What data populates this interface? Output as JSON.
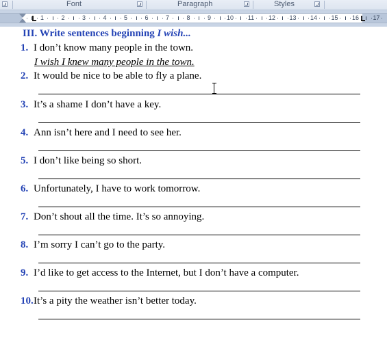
{
  "ribbon": {
    "groups": [
      {
        "label": "Font"
      },
      {
        "label": "Paragraph"
      },
      {
        "label": "Styles"
      }
    ]
  },
  "ruler": {
    "numbers": [
      "1",
      "2",
      "3",
      "4",
      "5",
      "6",
      "7",
      "8",
      "9",
      "10",
      "11",
      "12",
      "13",
      "14",
      "15",
      "16",
      "17"
    ]
  },
  "document": {
    "heading_prefix": "III. Write sentences beginning ",
    "heading_italic": "I wish...",
    "example": "I wish I knew many people in the town.",
    "items": [
      {
        "num": "1.",
        "text": "I don’t know many people in the town."
      },
      {
        "num": "2.",
        "text": "It would be nice to be able to fly a plane."
      },
      {
        "num": "3.",
        "text": "It’s a shame I don’t have a key."
      },
      {
        "num": "4.",
        "text": "Ann isn’t here and I need to see her."
      },
      {
        "num": "5.",
        "text": "I don’t like being so short."
      },
      {
        "num": "6.",
        "text": "Unfortunately, I have to work tomorrow."
      },
      {
        "num": "7.",
        "text": "Don’t shout all the time. It’s so annoying."
      },
      {
        "num": "8.",
        "text": "I’m sorry I can’t go to the party."
      },
      {
        "num": "9.",
        "text": "I’d like to get access to the Internet, but I don’t have a computer."
      },
      {
        "num": "10.",
        "text": "It’s a pity the weather isn’t better today."
      }
    ]
  },
  "colors": {
    "heading": "#2443b5",
    "number": "#2443b5",
    "text": "#000000"
  }
}
